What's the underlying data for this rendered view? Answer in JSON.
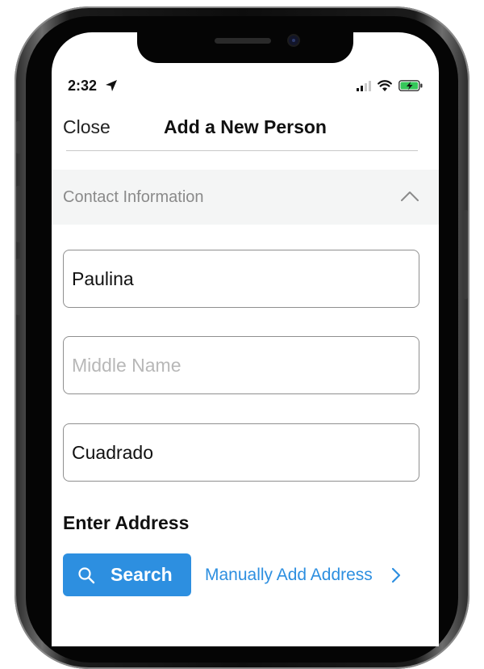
{
  "status_bar": {
    "time": "2:32"
  },
  "nav": {
    "close_label": "Close",
    "title": "Add a New Person"
  },
  "section": {
    "title": "Contact Information"
  },
  "form": {
    "first_name_value": "Paulina",
    "middle_name_value": "",
    "middle_name_placeholder": "Middle Name",
    "last_name_value": "Cuadrado"
  },
  "address": {
    "heading": "Enter Address",
    "search_label": "Search",
    "manual_link_label": "Manually Add Address"
  },
  "colors": {
    "accent": "#2d8fe0",
    "battery_fill": "#35c759"
  }
}
